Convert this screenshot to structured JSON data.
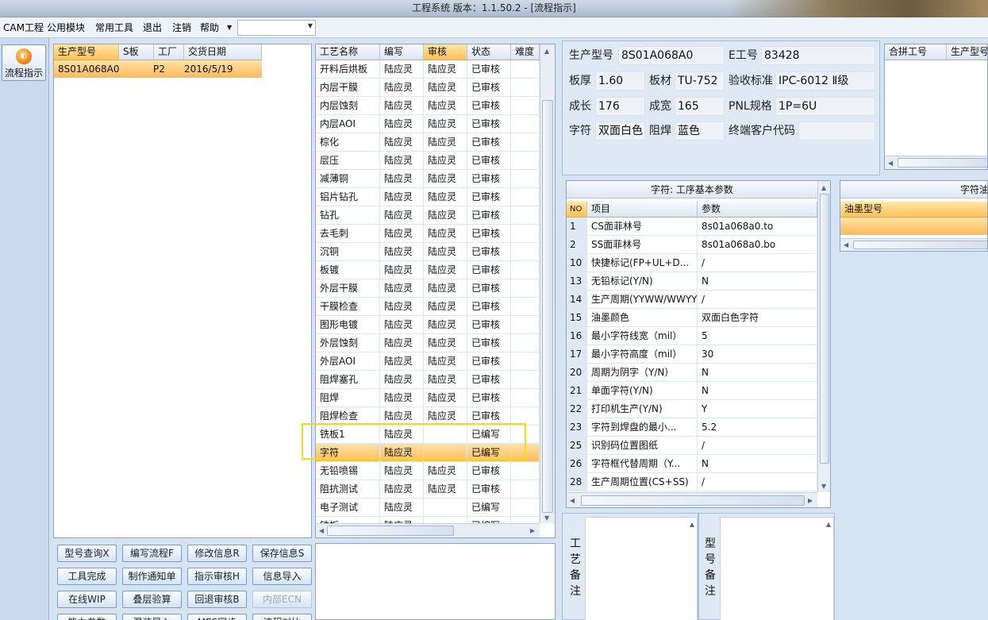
{
  "window": {
    "title": "工程系统   版本：1.1.50.2 - [流程指示]"
  },
  "menu": {
    "items": [
      "CAM工程",
      "公用模块",
      "常用工具",
      "退出",
      "注销",
      "帮助"
    ],
    "combo_value": ""
  },
  "sidebar": {
    "flow_button": "流程指示"
  },
  "orders": {
    "columns": [
      "生产型号",
      "S板",
      "工厂",
      "交货日期"
    ],
    "rows": [
      {
        "model": "8S01A068A0",
        "s": "",
        "factory": "P2",
        "date": "2016/5/19"
      }
    ]
  },
  "process": {
    "columns": [
      "工艺名称",
      "编写",
      "审核",
      "状态",
      "难度"
    ],
    "rows": [
      {
        "name": "开料后烘板",
        "writer": "陆应灵",
        "reviewer": "陆应灵",
        "status": "已审核"
      },
      {
        "name": "内层干膜",
        "writer": "陆应灵",
        "reviewer": "陆应灵",
        "status": "已审核"
      },
      {
        "name": "内层蚀刻",
        "writer": "陆应灵",
        "reviewer": "陆应灵",
        "status": "已审核"
      },
      {
        "name": "内层AOI",
        "writer": "陆应灵",
        "reviewer": "陆应灵",
        "status": "已审核"
      },
      {
        "name": "棕化",
        "writer": "陆应灵",
        "reviewer": "陆应灵",
        "status": "已审核"
      },
      {
        "name": "层压",
        "writer": "陆应灵",
        "reviewer": "陆应灵",
        "status": "已审核"
      },
      {
        "name": "减薄铜",
        "writer": "陆应灵",
        "reviewer": "陆应灵",
        "status": "已审核"
      },
      {
        "name": "铝片钻孔",
        "writer": "陆应灵",
        "reviewer": "陆应灵",
        "status": "已审核"
      },
      {
        "name": "钻孔",
        "writer": "陆应灵",
        "reviewer": "陆应灵",
        "status": "已审核"
      },
      {
        "name": "去毛刺",
        "writer": "陆应灵",
        "reviewer": "陆应灵",
        "status": "已审核"
      },
      {
        "name": "沉铜",
        "writer": "陆应灵",
        "reviewer": "陆应灵",
        "status": "已审核"
      },
      {
        "name": "板镀",
        "writer": "陆应灵",
        "reviewer": "陆应灵",
        "status": "已审核"
      },
      {
        "name": "外层干膜",
        "writer": "陆应灵",
        "reviewer": "陆应灵",
        "status": "已审核"
      },
      {
        "name": "干膜检查",
        "writer": "陆应灵",
        "reviewer": "陆应灵",
        "status": "已审核"
      },
      {
        "name": "图形电镀",
        "writer": "陆应灵",
        "reviewer": "陆应灵",
        "status": "已审核"
      },
      {
        "name": "外层蚀刻",
        "writer": "陆应灵",
        "reviewer": "陆应灵",
        "status": "已审核"
      },
      {
        "name": "外层AOI",
        "writer": "陆应灵",
        "reviewer": "陆应灵",
        "status": "已审核"
      },
      {
        "name": "阻焊塞孔",
        "writer": "陆应灵",
        "reviewer": "陆应灵",
        "status": "已审核"
      },
      {
        "name": "阻焊",
        "writer": "陆应灵",
        "reviewer": "陆应灵",
        "status": "已审核"
      },
      {
        "name": "阻焊检查",
        "writer": "陆应灵",
        "reviewer": "陆应灵",
        "status": "已审核"
      },
      {
        "name": "铣板1",
        "writer": "陆应灵",
        "reviewer": "",
        "status": "已编写"
      },
      {
        "name": "字符",
        "writer": "陆应灵",
        "reviewer": "",
        "status": "已编写"
      },
      {
        "name": "无铅喷锡",
        "writer": "陆应灵",
        "reviewer": "陆应灵",
        "status": "已审核"
      },
      {
        "name": "阻抗测试",
        "writer": "陆应灵",
        "reviewer": "陆应灵",
        "status": "已审核"
      },
      {
        "name": "电子测试",
        "writer": "陆应灵",
        "reviewer": "",
        "status": "已编写"
      },
      {
        "name": "铣板",
        "writer": "陆应灵",
        "reviewer": "",
        "status": "已编写"
      }
    ]
  },
  "actions": {
    "row1": [
      "型号查询X",
      "编写流程F",
      "修改信息R",
      "保存信息S"
    ],
    "row2": [
      "工具完成",
      "制作通知单",
      "指示审核H",
      "信息导入"
    ],
    "row3": [
      "在线WIP",
      "叠层验算",
      "回退审核B",
      "内部ECN"
    ],
    "row4": [
      "能力参数",
      "混装导入",
      "MES同步",
      "流程对比"
    ]
  },
  "info": {
    "model_label": "生产型号",
    "model": "8S01A068A0",
    "eng_label": "E工号",
    "eng": "83428",
    "thick_label": "板厚",
    "thick": "1.60",
    "material_label": "板材",
    "material": "TU-752",
    "std_label": "验收标准",
    "std": "IPC-6012 Ⅱ级",
    "len_label": "成长",
    "len": "176",
    "wid_label": "成宽",
    "wid": "165",
    "pnl_label": "PNL规格",
    "pnl": "1P=6U",
    "char_label": "字符",
    "char": "双面白色",
    "mask_label": "阻焊",
    "mask": "蓝色",
    "cust_label": "终端客户代码",
    "cust": ""
  },
  "merge": {
    "columns": [
      "合拼工号",
      "生产型号"
    ]
  },
  "params": {
    "title": "字符: 工序基本参数",
    "columns": [
      "NO",
      "项目",
      "参数"
    ],
    "rows": [
      {
        "no": "1",
        "item": "CS面菲林号",
        "value": "8s01a068a0.to"
      },
      {
        "no": "2",
        "item": "SS面菲林号",
        "value": "8s01a068a0.bo"
      },
      {
        "no": "10",
        "item": "快捷标记(FP+UL+D...",
        "value": "/"
      },
      {
        "no": "13",
        "item": "无铅标记(Y/N)",
        "value": "N"
      },
      {
        "no": "14",
        "item": "生产周期(YYWW/WWYY)",
        "value": "/"
      },
      {
        "no": "15",
        "item": "油墨颜色",
        "value": "双面白色字符"
      },
      {
        "no": "16",
        "item": "最小字符线宽（mil）",
        "value": "5"
      },
      {
        "no": "17",
        "item": "最小字符高度（mil）",
        "value": "30"
      },
      {
        "no": "20",
        "item": "周期为阴字（Y/N）",
        "value": "N"
      },
      {
        "no": "21",
        "item": "单面字符(Y/N)",
        "value": "N"
      },
      {
        "no": "22",
        "item": "打印机生产(Y/N)",
        "value": "Y"
      },
      {
        "no": "23",
        "item": "字符到焊盘的最小...",
        "value": "5.2"
      },
      {
        "no": "25",
        "item": "识别码位置图纸",
        "value": "/"
      },
      {
        "no": "26",
        "item": "字符框代替周期（Y...",
        "value": "N"
      },
      {
        "no": "28",
        "item": "生产周期位置(CS+SS)",
        "value": "/"
      }
    ]
  },
  "ink": {
    "title": "字符油",
    "column": "油墨型号"
  },
  "notes": {
    "process_label": [
      "工",
      "艺",
      "备",
      "注"
    ],
    "model_label": [
      "型",
      "号",
      "备",
      "注"
    ]
  }
}
